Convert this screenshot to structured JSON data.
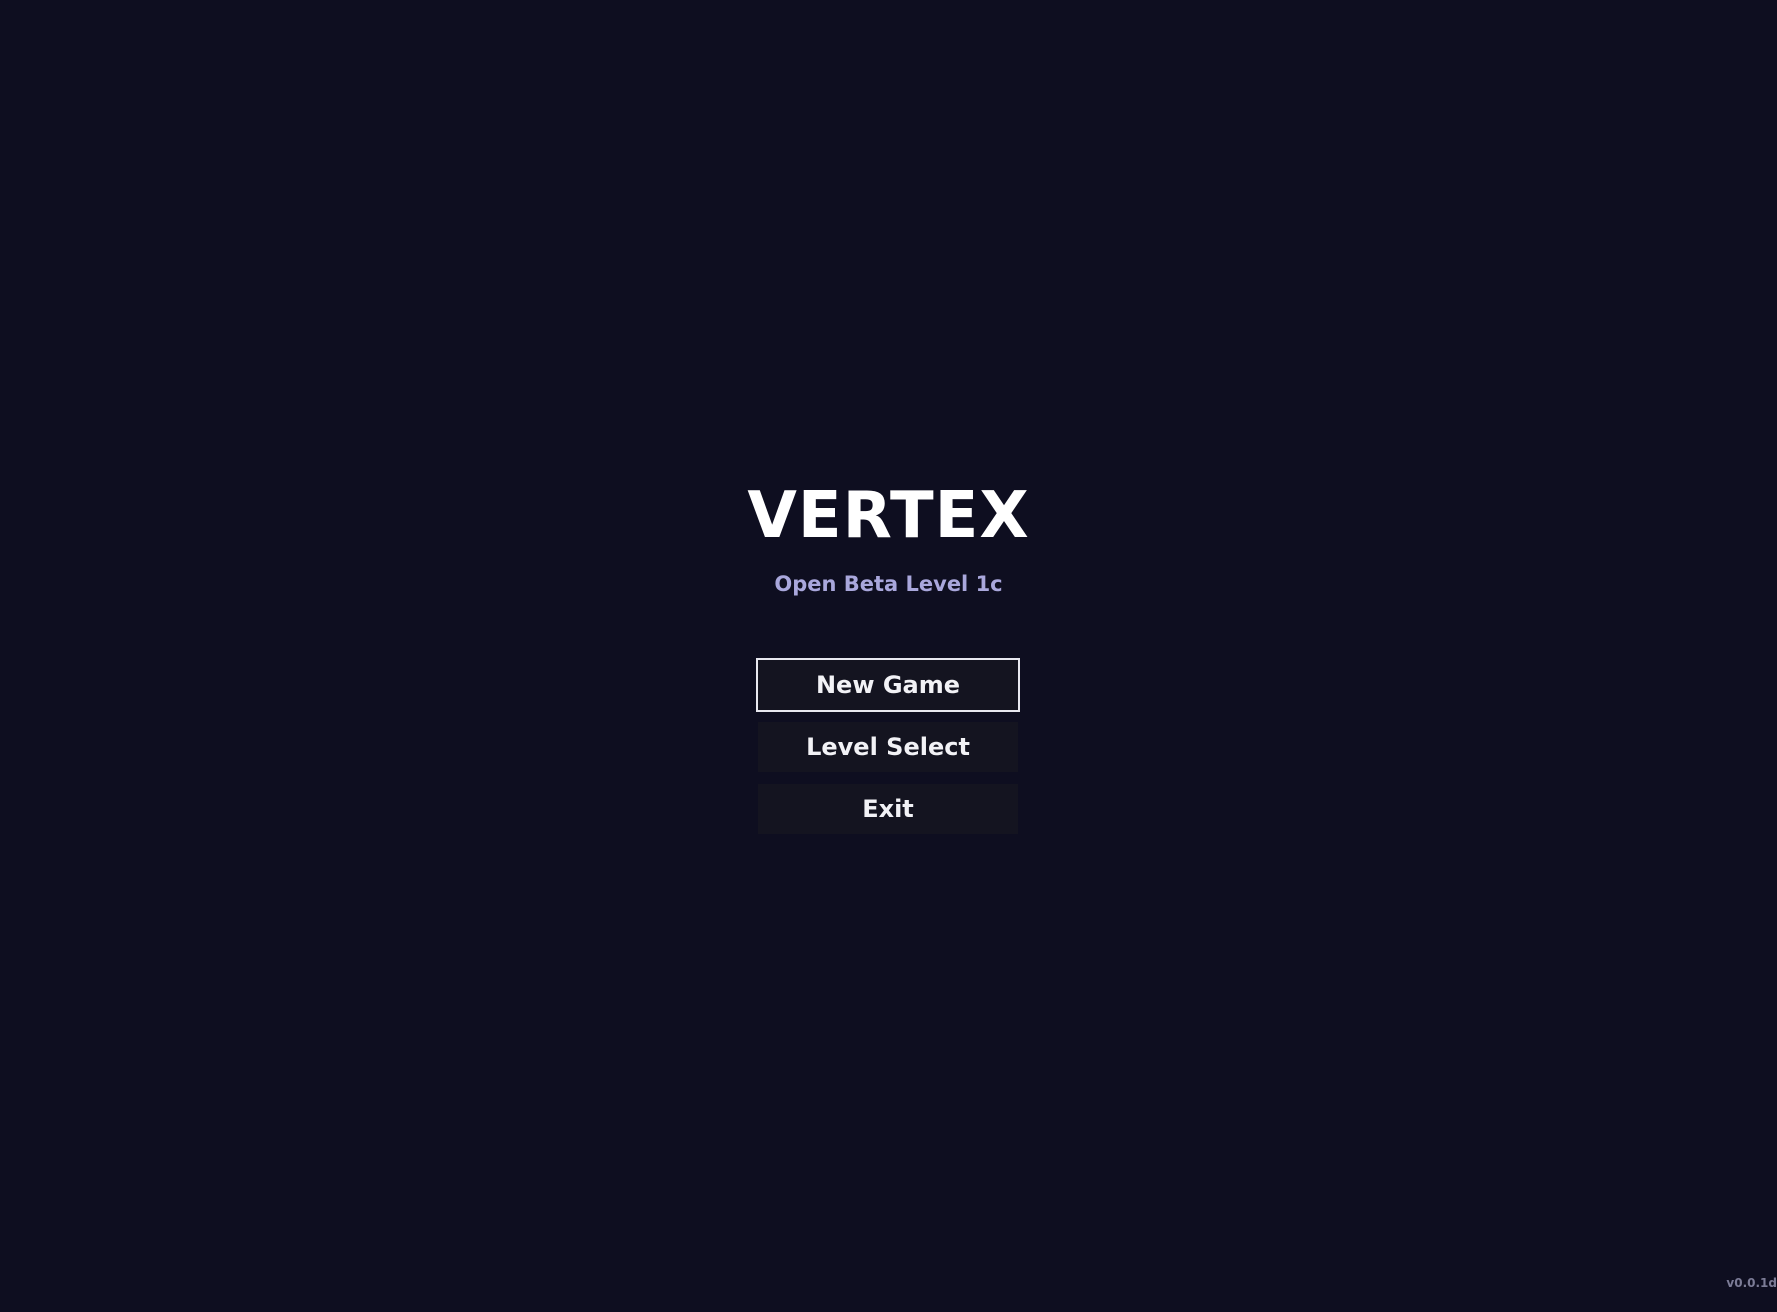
{
  "game": {
    "title": "VERTEX",
    "subtitle": "Open Beta Level 1c",
    "version": "v0.0.1d"
  },
  "menu": {
    "items": [
      {
        "label": "New Game",
        "selected": true
      },
      {
        "label": "Level Select",
        "selected": false
      },
      {
        "label": "Exit",
        "selected": false
      }
    ]
  },
  "colors": {
    "background": "#0e0e20",
    "button_background": "#141420",
    "subtitle": "#a9a7dc",
    "selected_border": "#e8e8f0"
  }
}
